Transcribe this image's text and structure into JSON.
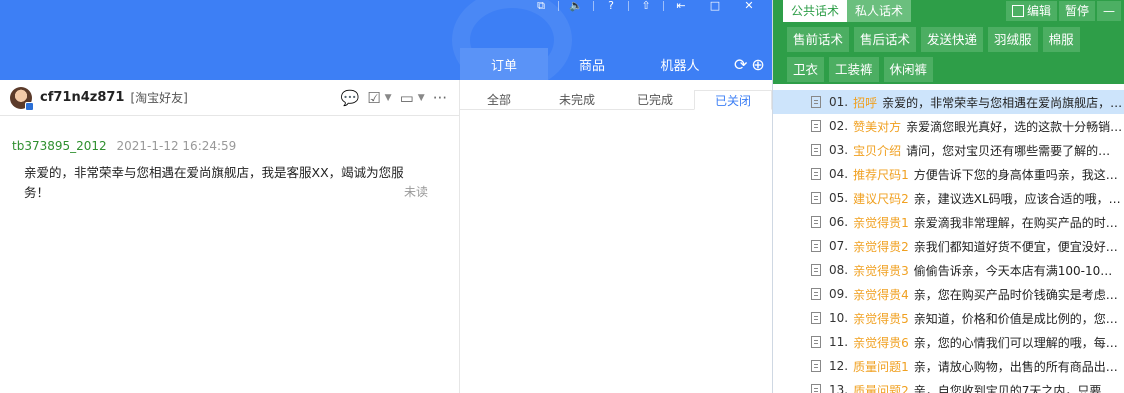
{
  "window": {
    "controls": [
      "⧉",
      "🔈",
      "?",
      "⇧",
      "⇤",
      "□",
      "✕"
    ]
  },
  "tabs": [
    {
      "label": "订单"
    },
    {
      "label": "商品"
    },
    {
      "label": "机器人"
    }
  ],
  "chat": {
    "contact_name": "cf71n4z871",
    "contact_tag": "[淘宝好友]",
    "message": {
      "sender": "tb373895_2012",
      "time": "2021-1-12 16:24:59",
      "text": "亲爱的，非常荣幸与您相遇在爱尚旗舰店，我是客服XX，竭诚为您服务！",
      "status": "未读"
    }
  },
  "order_tabs": [
    "全部",
    "未完成",
    "已完成",
    "已关闭"
  ],
  "right_panel": {
    "tabs": [
      "公共话术",
      "私人话术"
    ],
    "edit_label": "编辑",
    "pause_label": "暂停",
    "minimize_label": "—",
    "categories": [
      "售前话术",
      "售后话术",
      "发送快递",
      "羽绒服",
      "棉服",
      "卫衣",
      "工装裤",
      "休闲裤"
    ],
    "rows": [
      {
        "num": "01.",
        "key": "招呼",
        "text": "亲爱的，非常荣幸与您相遇在爱尚旗舰店，我…"
      },
      {
        "num": "02.",
        "key": "赞美对方",
        "text": "亲爱滴您眼光真好，选的这款十分畅销，…"
      },
      {
        "num": "03.",
        "key": "宝贝介绍",
        "text": "请问，您对宝贝还有哪些需要了解的…"
      },
      {
        "num": "04.",
        "key": "推荐尺码1",
        "text": "方便告诉下您的身高体重吗亲，我这…"
      },
      {
        "num": "05.",
        "key": "建议尺码2",
        "text": "亲，建议选XL码哦，应该合适的哦，这一…"
      },
      {
        "num": "06.",
        "key": "亲觉得贵1",
        "text": "亲爱滴我非常理解，在购买产品的时…"
      },
      {
        "num": "07.",
        "key": "亲觉得贵2",
        "text": "亲我们都知道好货不便宜，便宜没好…"
      },
      {
        "num": "08.",
        "key": "亲觉得贵3",
        "text": "偷偷告诉亲，今天本店有满100-10…"
      },
      {
        "num": "09.",
        "key": "亲觉得贵4",
        "text": "亲，您在购买产品时价钱确实是考虑…"
      },
      {
        "num": "10.",
        "key": "亲觉得贵5",
        "text": "亲知道，价格和价值是成比例的，您…"
      },
      {
        "num": "11.",
        "key": "亲觉得贵6",
        "text": "亲，您的心情我们可以理解的哦，每…"
      },
      {
        "num": "12.",
        "key": "质量问题1",
        "text": "亲，请放心购物，出售的所有商品出…"
      },
      {
        "num": "13.",
        "key": "质量问题2",
        "text": "亲，自您收到宝贝的7天之内，只要…"
      }
    ]
  }
}
